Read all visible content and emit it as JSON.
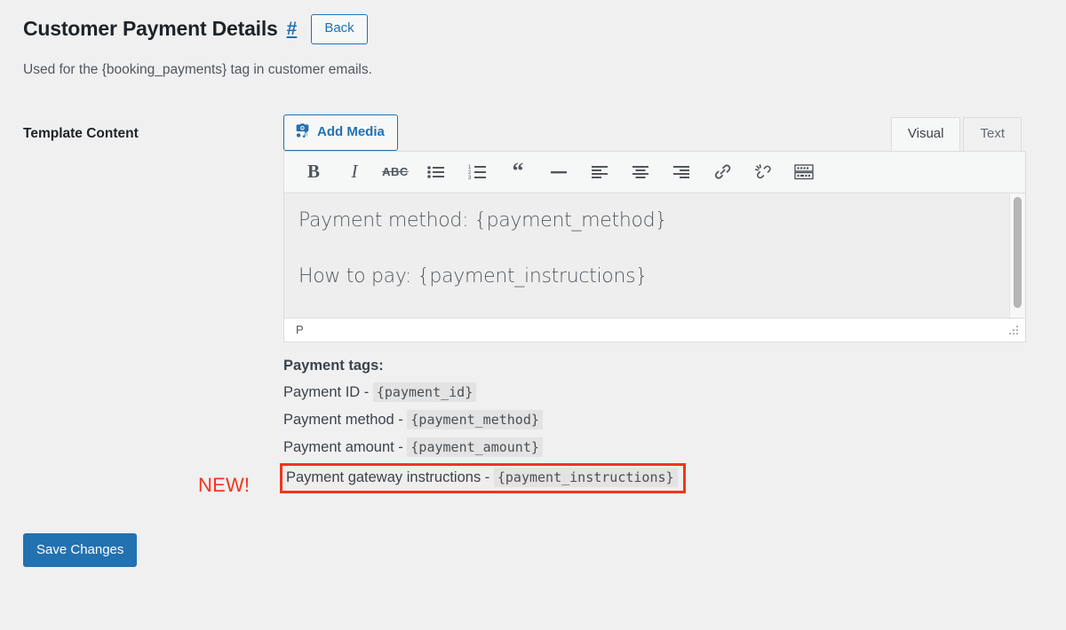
{
  "header": {
    "title": "Customer Payment Details",
    "anchor": "#",
    "back_label": "Back",
    "description": "Used for the {booking_payments} tag in customer emails."
  },
  "form": {
    "label": "Template Content"
  },
  "editor": {
    "add_media_label": "Add Media",
    "add_media_icon": "media-camera-music-icon",
    "tabs": [
      {
        "label": "Visual",
        "active": true
      },
      {
        "label": "Text",
        "active": false
      }
    ],
    "toolbar_buttons": [
      {
        "name": "bold-icon",
        "title": "Bold"
      },
      {
        "name": "italic-icon",
        "title": "Italic"
      },
      {
        "name": "strikethrough-icon",
        "title": "Strikethrough"
      },
      {
        "name": "bulleted-list-icon",
        "title": "Bulleted list"
      },
      {
        "name": "numbered-list-icon",
        "title": "Numbered list"
      },
      {
        "name": "blockquote-icon",
        "title": "Blockquote"
      },
      {
        "name": "horizontal-rule-icon",
        "title": "Horizontal line"
      },
      {
        "name": "align-left-icon",
        "title": "Align left"
      },
      {
        "name": "align-center-icon",
        "title": "Align center"
      },
      {
        "name": "align-right-icon",
        "title": "Align right"
      },
      {
        "name": "insert-link-icon",
        "title": "Insert/edit link"
      },
      {
        "name": "remove-link-icon",
        "title": "Remove link"
      },
      {
        "name": "toolbar-toggle-icon",
        "title": "Toolbar Toggle"
      }
    ],
    "content_lines": [
      "Payment method: {payment_method}",
      "How to pay: {payment_instructions}"
    ],
    "statusbar_path": "P"
  },
  "tags": {
    "title": "Payment tags:",
    "items": [
      {
        "label": "Payment ID -",
        "code": "{payment_id}",
        "highlighted": false
      },
      {
        "label": "Payment method -",
        "code": "{payment_method}",
        "highlighted": false
      },
      {
        "label": "Payment amount -",
        "code": "{payment_amount}",
        "highlighted": false
      },
      {
        "label": "Payment gateway instructions -",
        "code": "{payment_instructions}",
        "highlighted": true
      }
    ],
    "new_badge": "NEW!"
  },
  "footer": {
    "save_label": "Save Changes"
  },
  "colors": {
    "page_background": "#f0f0f1",
    "accent_blue": "#2271b1",
    "annotation_red": "#f4341c",
    "editor_content_bg": "#eeeeee",
    "code_bg": "#e3e3e3"
  }
}
